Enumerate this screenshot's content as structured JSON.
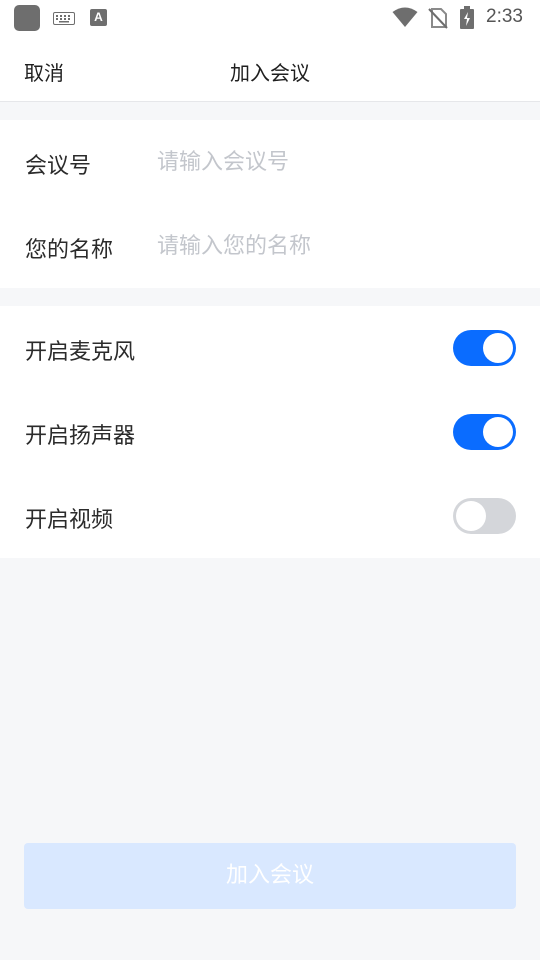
{
  "status_bar": {
    "a_icon_label": "A",
    "time": "2:33",
    "icons": [
      "app-icon",
      "keyboard-icon",
      "a-icon",
      "wifi-icon",
      "no-sim-icon",
      "battery-charging-icon"
    ]
  },
  "nav": {
    "cancel_label": "取消",
    "title": "加入会议"
  },
  "form": {
    "meeting_id": {
      "label": "会议号",
      "placeholder": "请输入会议号",
      "value": ""
    },
    "name": {
      "label": "您的名称",
      "placeholder": "请输入您的名称",
      "value": ""
    }
  },
  "toggles": [
    {
      "label": "开启麦克风",
      "on": true
    },
    {
      "label": "开启扬声器",
      "on": true
    },
    {
      "label": "开启视频",
      "on": false
    }
  ],
  "join_button": {
    "label": "加入会议",
    "enabled": false
  },
  "colors": {
    "accent": "#0a6cff",
    "toggle_off": "#d4d6da",
    "button_disabled": "#d9e8ff",
    "page_background": "#f6f7f9",
    "placeholder": "#c3c6cc"
  }
}
